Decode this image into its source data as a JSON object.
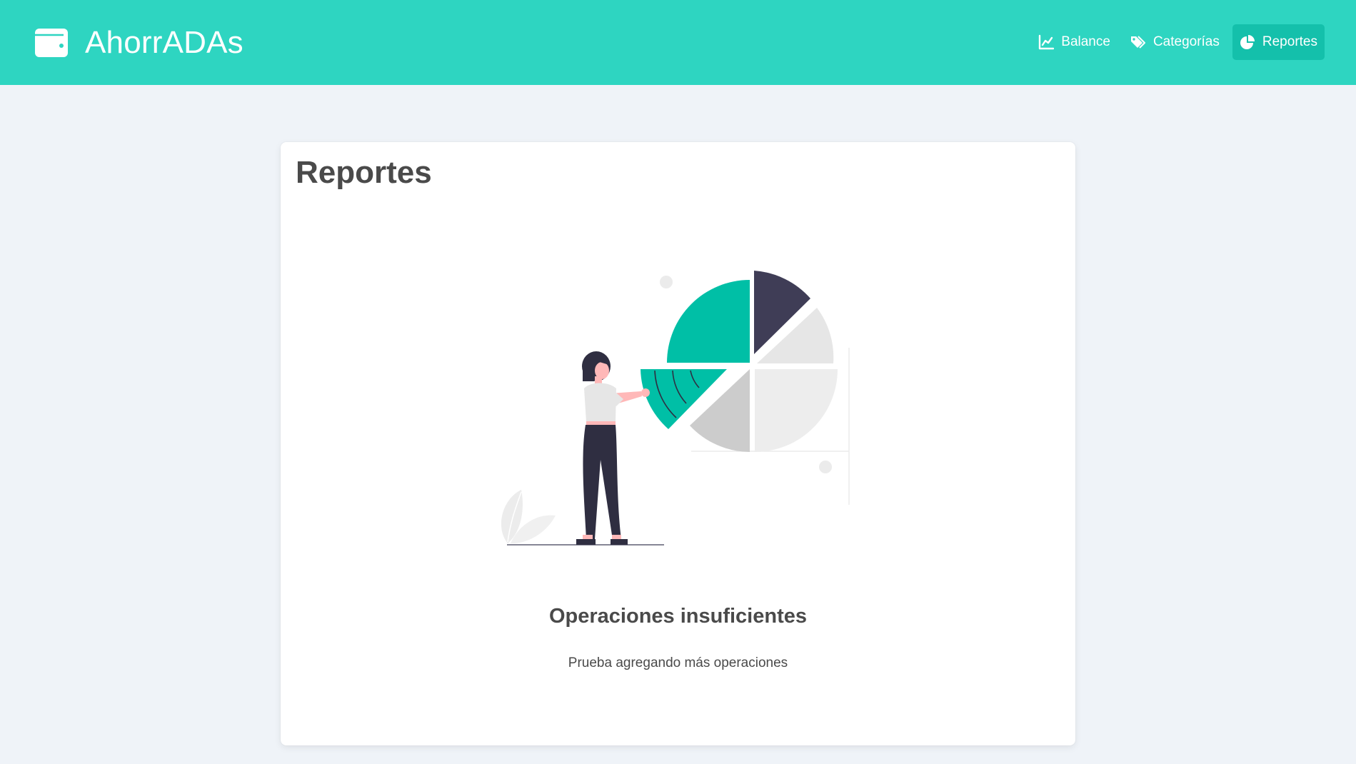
{
  "app": {
    "title": "AhorrADAs",
    "brand_icon": "wallet-icon"
  },
  "nav": {
    "items": [
      {
        "label": "Balance",
        "icon": "chart-line-icon",
        "active": false
      },
      {
        "label": "Categorías",
        "icon": "tags-icon",
        "active": false
      },
      {
        "label": "Reportes",
        "icon": "chart-pie-icon",
        "active": true
      }
    ]
  },
  "main": {
    "title": "Reportes",
    "empty_state": {
      "illustration": "woman-presenting-pie-chart-illustration",
      "title": "Operaciones insuficientes",
      "subtitle": "Prueba agregando más operaciones"
    }
  },
  "colors": {
    "primary": "#2ed5c1",
    "primary_dark": "#14c0ab",
    "accent": "#00bfa6",
    "background": "#eff3f8",
    "text": "#4a4a4a"
  }
}
